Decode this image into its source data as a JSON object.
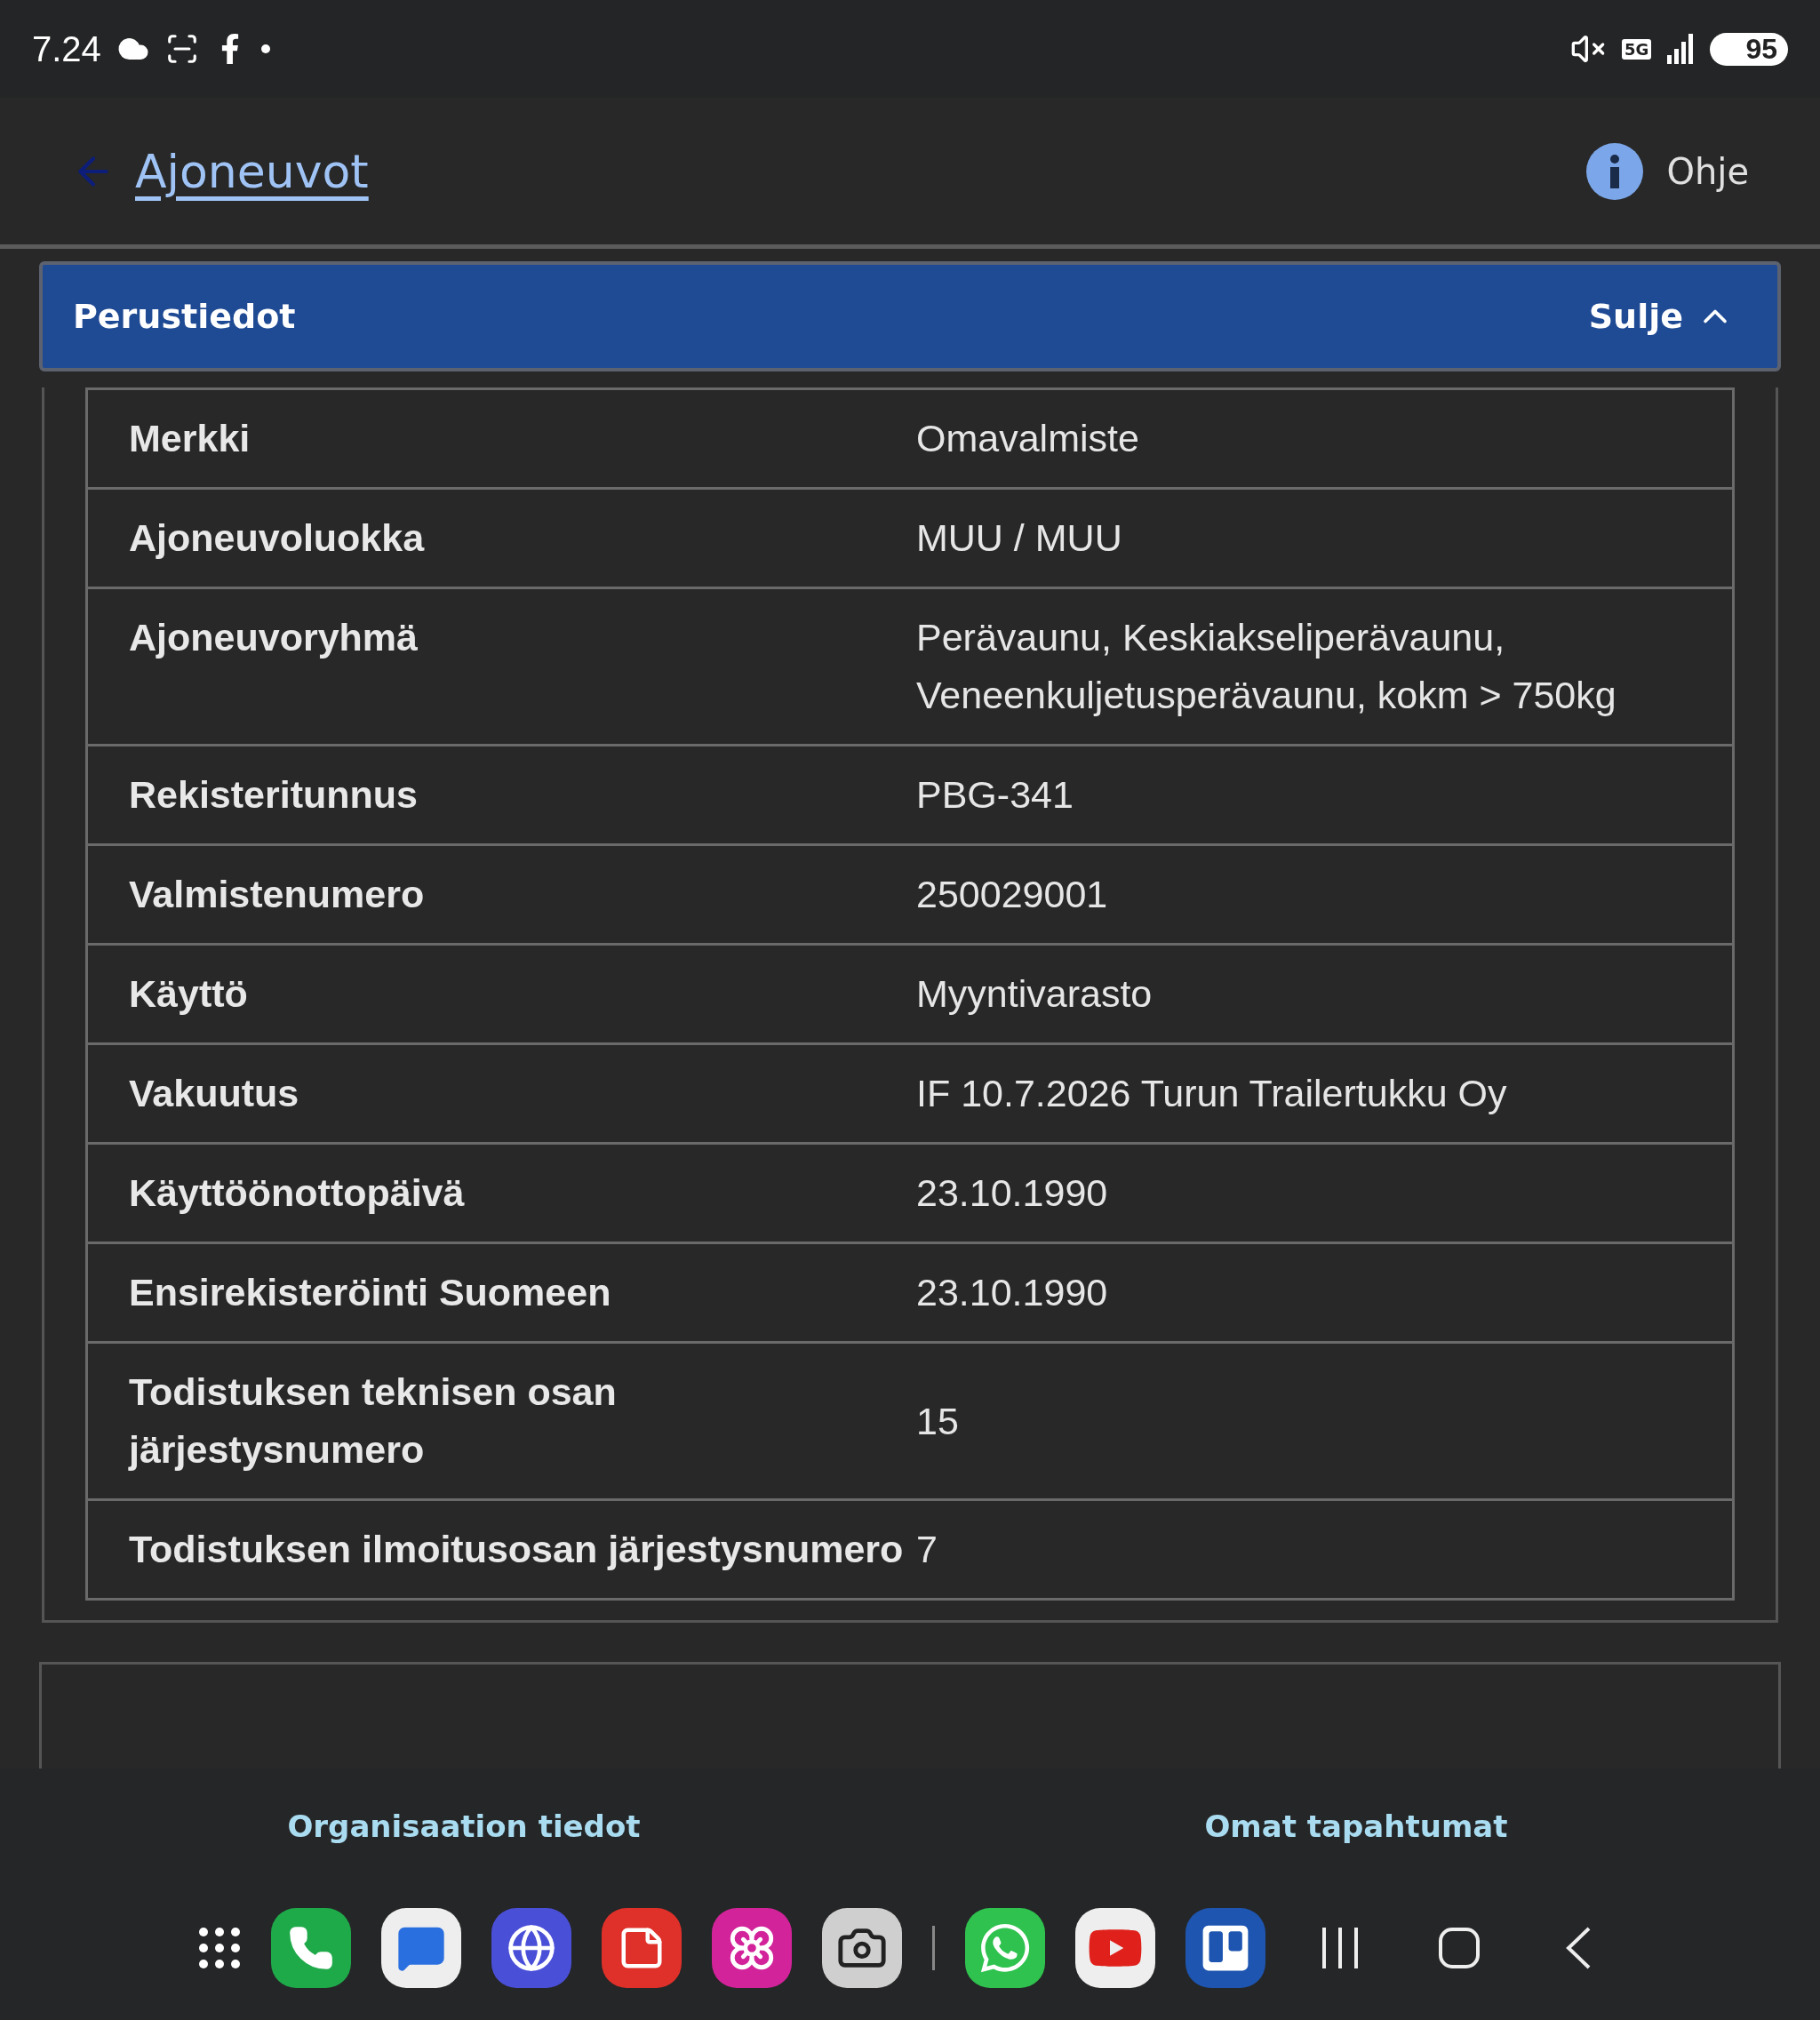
{
  "status_bar": {
    "time": "7.24",
    "network": "5G",
    "battery": "95"
  },
  "header": {
    "back_link": "Ajoneuvot",
    "help": "Ohje"
  },
  "section": {
    "title": "Perustiedot",
    "toggle": "Sulje",
    "expanded": true,
    "rows": [
      {
        "label": "Merkki",
        "value": "Omavalmiste"
      },
      {
        "label": "Ajoneuvoluokka",
        "value": "MUU / MUU"
      },
      {
        "label": "Ajoneuvoryhmä",
        "value": "Perävaunu, Keskiakseliperävaunu, Veneenkuljetusperävaunu, kokm > 750kg"
      },
      {
        "label": "Rekisteritunnus",
        "value": "PBG-341"
      },
      {
        "label": "Valmistenumero",
        "value": "250029001"
      },
      {
        "label": "Käyttö",
        "value": "Myyntivarasto"
      },
      {
        "label": "Vakuutus",
        "value": "IF 10.7.2026 Turun Trailertukku Oy"
      },
      {
        "label": "Käyttöönottopäivä",
        "value": "23.10.1990"
      },
      {
        "label": "Ensirekisteröinti Suomeen",
        "value": "23.10.1990"
      },
      {
        "label": "Todistuksen teknisen osan järjestysnumero",
        "value": "15"
      },
      {
        "label": "Todistuksen ilmoitusosan järjestysnumero",
        "value": "7"
      }
    ]
  },
  "bottom_tabs": [
    {
      "label": "Organisaation tiedot"
    },
    {
      "label": "Omat tapahtumat"
    }
  ]
}
